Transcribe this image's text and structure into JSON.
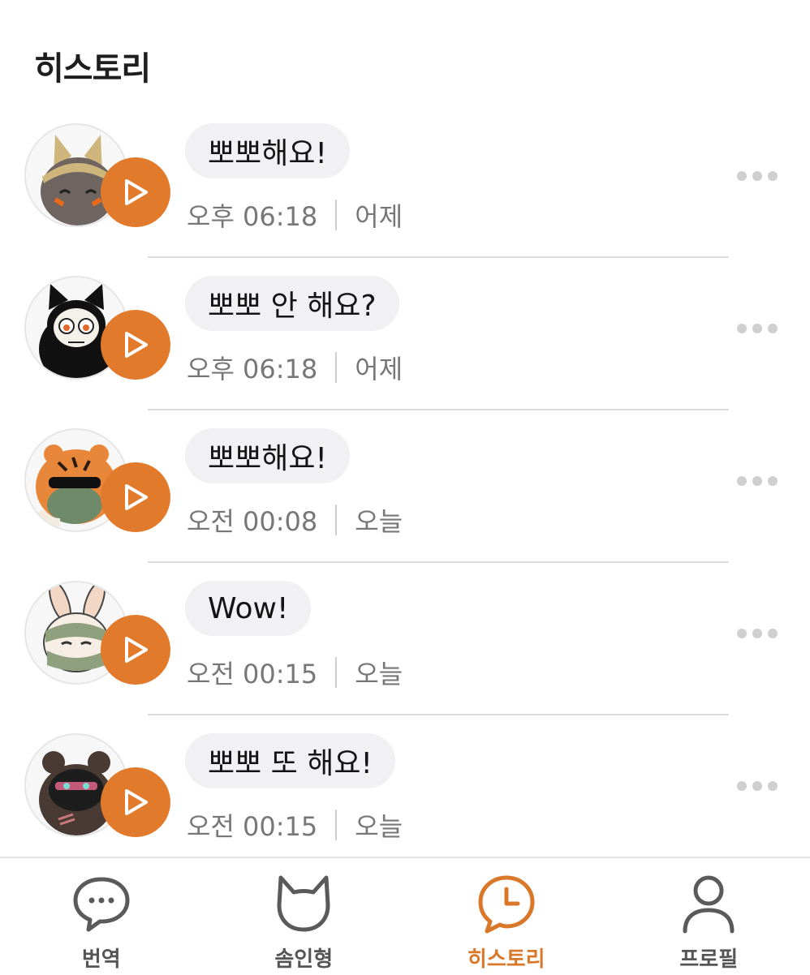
{
  "header": {
    "title": "히스토리"
  },
  "history": [
    {
      "message": "뽀뽀해요!",
      "time": "오후 06:18",
      "day": "어제",
      "avatar": "cat-hood-character-avatar"
    },
    {
      "message": "뽀뽀 안 해요?",
      "time": "오후 06:18",
      "day": "어제",
      "avatar": "black-cat-skull-character-avatar"
    },
    {
      "message": "뽀뽀해요!",
      "time": "오전 00:08",
      "day": "오늘",
      "avatar": "tiger-sunglasses-character-avatar"
    },
    {
      "message": "Wow!",
      "time": "오전 00:15",
      "day": "오늘",
      "avatar": "rabbit-masked-character-avatar"
    },
    {
      "message": "뽀뽀 또 해요!",
      "time": "오전 00:15",
      "day": "오늘",
      "avatar": "bear-masked-character-avatar"
    }
  ],
  "nav": {
    "items": [
      {
        "label": "번역",
        "icon": "chat-bubble-icon",
        "active": false
      },
      {
        "label": "솜인형",
        "icon": "cat-head-icon",
        "active": false
      },
      {
        "label": "히스토리",
        "icon": "clock-bubble-icon",
        "active": true
      },
      {
        "label": "프로필",
        "icon": "person-icon",
        "active": false
      }
    ]
  },
  "colors": {
    "accent": "#e27a2c",
    "active_label": "#d9782a",
    "bubble_bg": "#f1f1f3",
    "meta_text": "#777777",
    "icon_gray": "#555555"
  }
}
